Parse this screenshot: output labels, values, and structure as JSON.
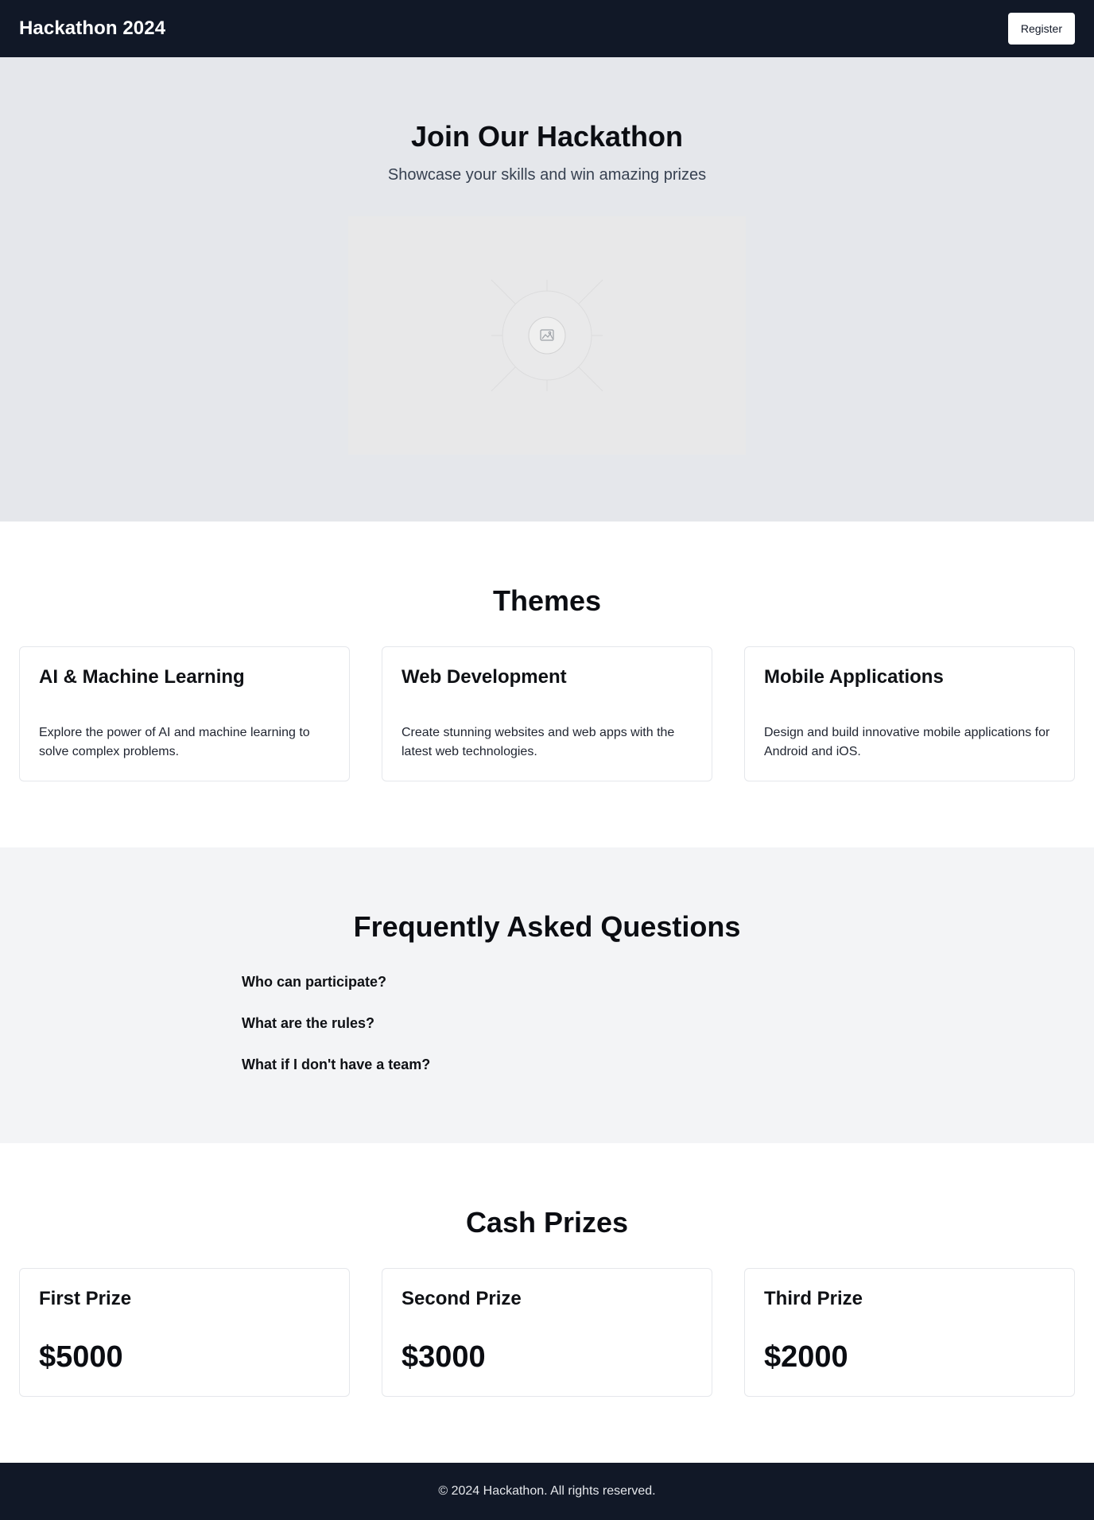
{
  "header": {
    "brand": "Hackathon 2024",
    "register_label": "Register"
  },
  "hero": {
    "title": "Join Our Hackathon",
    "subtitle": "Showcase your skills and win amazing prizes",
    "image_icon": "image-placeholder-icon"
  },
  "themes": {
    "title": "Themes",
    "items": [
      {
        "title": "AI & Machine Learning",
        "description": "Explore the power of AI and machine learning to solve complex problems."
      },
      {
        "title": "Web Development",
        "description": "Create stunning websites and web apps with the latest web technologies."
      },
      {
        "title": "Mobile Applications",
        "description": "Design and build innovative mobile applications for Android and iOS."
      }
    ]
  },
  "faq": {
    "title": "Frequently Asked Questions",
    "items": [
      "Who can participate?",
      "What are the rules?",
      "What if I don't have a team?"
    ]
  },
  "prizes": {
    "title": "Cash Prizes",
    "items": [
      {
        "title": "First Prize",
        "amount": "$5000"
      },
      {
        "title": "Second Prize",
        "amount": "$3000"
      },
      {
        "title": "Third Prize",
        "amount": "$2000"
      }
    ]
  },
  "footer": {
    "text": "© 2024 Hackathon. All rights reserved."
  },
  "colors": {
    "dark": "#111827",
    "hero_bg": "#e5e7eb",
    "faq_bg": "#f3f4f6",
    "card_border": "#e5e7eb"
  }
}
